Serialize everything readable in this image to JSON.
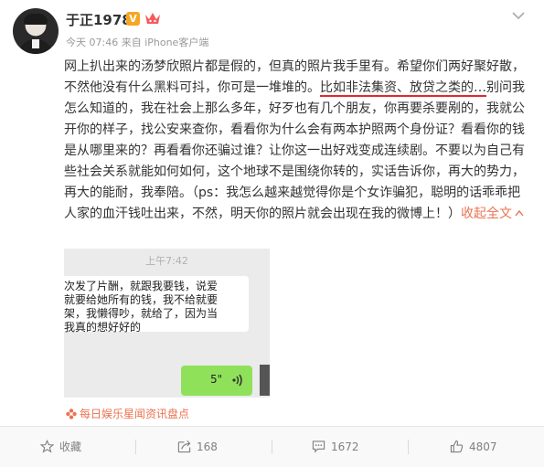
{
  "post": {
    "username": "于正1978",
    "verified_badge": "V",
    "meta": "今天 07:46 来自 iPhone客户端",
    "text_part1": "网上扒出来的汤梦欣照片都是假的，但真的照片我手里有。希望你们两好聚好散，不然他没有什么黑料可抖，你可是一堆堆的。",
    "text_underlined": "比如非法集资、放贷之类的…",
    "text_part2": "别问我怎么知道的，我在社会上那么多年，好歹也有几个朋友，你再要杀要剐的，我就公开你的样子，找公安来查你，看看你为什么会有两本护照两个身份证？看看你的钱是从哪里来的？再看看你还骗过谁？让你这一出好戏变成连续剧。不要以为自己有些社会关系就能如何如何，这个地球不是围绕你转的，实话告诉你，再大的势力，再大的能耐，我奉陪。（ps：我怎么越来越觉得你是个女诈骗犯，聪明的话乖乖把人家的血汗钱吐出来，不然，明天你的照片就会出现在我的微博上！）",
    "expand_label": "收起全文",
    "expand_icon": "chevron-up-icon"
  },
  "chat_image": {
    "time": "上午7:42",
    "left_lines": [
      "次发了片酬，就跟我要钱，说爱",
      "就要给她所有的钱，我不给就要",
      "架，我懒得吵，就给了，因为当",
      "我真的想好好的"
    ],
    "voice_duration": "5\""
  },
  "source": "每日娱乐星闻资讯盘点",
  "actions": [
    {
      "label": "收藏",
      "icon": "star-icon"
    },
    {
      "label": "168",
      "icon": "share-icon"
    },
    {
      "label": "1672",
      "icon": "comment-icon"
    },
    {
      "label": "4807",
      "icon": "like-icon"
    }
  ],
  "colors": {
    "link_orange": "#eb7350",
    "underline_red": "#e02b2b",
    "badge_gold": "#f6a623",
    "voice_bubble_green": "#8fe15a"
  }
}
